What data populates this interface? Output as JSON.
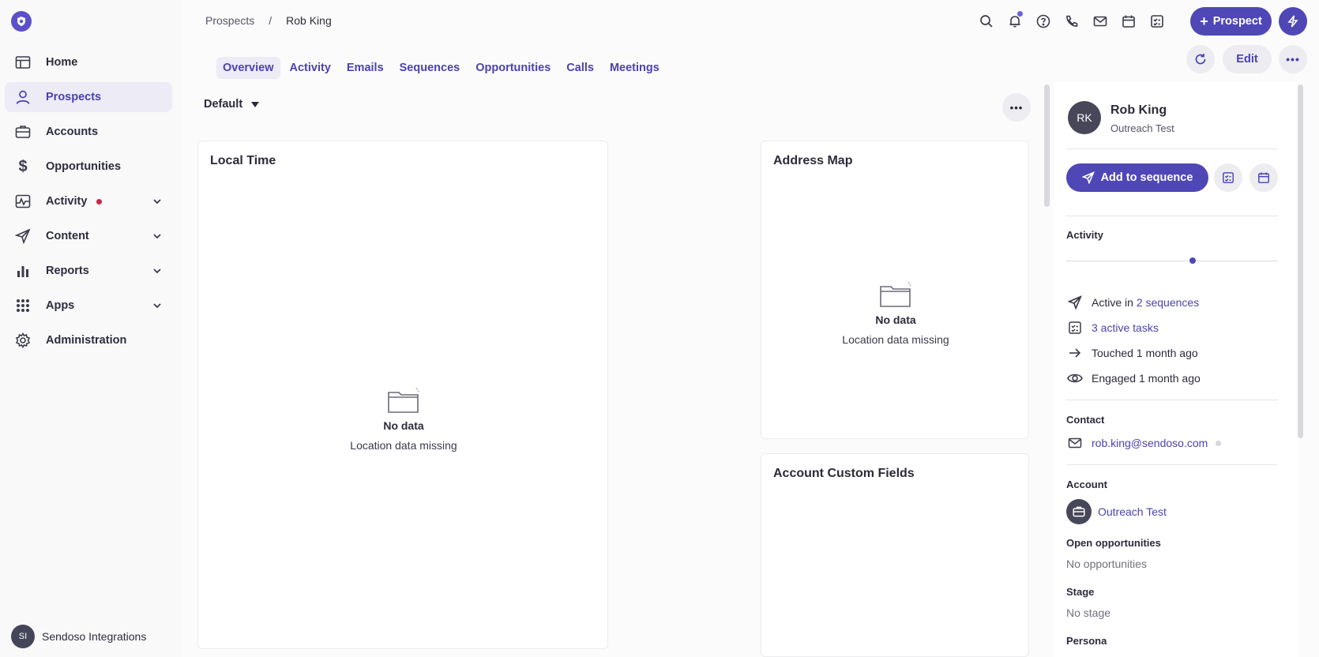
{
  "sidebar": {
    "logo_icon": "shield-icon",
    "items": [
      {
        "label": "Home",
        "icon": "table-icon",
        "active": false
      },
      {
        "label": "Prospects",
        "icon": "person-icon",
        "active": true
      },
      {
        "label": "Accounts",
        "icon": "briefcase-icon",
        "active": false
      },
      {
        "label": "Opportunities",
        "icon": "dollar-icon",
        "active": false
      },
      {
        "label": "Activity",
        "icon": "activity-icon",
        "active": false,
        "has_badge": true,
        "expandable": true
      },
      {
        "label": "Content",
        "icon": "send-icon",
        "active": false,
        "expandable": true
      },
      {
        "label": "Reports",
        "icon": "bar-chart-icon",
        "active": false,
        "expandable": true
      },
      {
        "label": "Apps",
        "icon": "grid-icon",
        "active": false,
        "expandable": true
      },
      {
        "label": "Administration",
        "icon": "gear-icon",
        "active": false
      }
    ],
    "user": {
      "initials": "SI",
      "name": "Sendoso Integrations"
    }
  },
  "header": {
    "breadcrumb": {
      "parent": "Prospects",
      "separator": "/",
      "current": "Rob King"
    },
    "add_button_label": "Prospect",
    "icons": [
      "search-icon",
      "bell-icon",
      "help-icon",
      "phone-icon",
      "mail-icon",
      "calendar-icon",
      "task-icon"
    ]
  },
  "tabs": [
    "Overview",
    "Activity",
    "Emails",
    "Sequences",
    "Opportunities",
    "Calls",
    "Meetings"
  ],
  "toolbar": {
    "edit_label": "Edit"
  },
  "main": {
    "view_selector": "Default",
    "cards": {
      "local_time": {
        "title": "Local Time",
        "empty_title": "No data",
        "empty_desc": "Location data missing"
      },
      "address_map": {
        "title": "Address Map",
        "empty_title": "No data",
        "empty_desc": "Location data missing"
      },
      "account_custom_fields": {
        "title": "Account Custom Fields"
      }
    }
  },
  "panel": {
    "initials": "RK",
    "name": "Rob King",
    "subtitle": "Outreach Test",
    "add_to_sequence_label": "Add to sequence",
    "activity_label": "Activity",
    "stats": {
      "active_in_prefix": "Active in",
      "active_in_link": "2 sequences",
      "tasks_link": "3 active tasks",
      "touched": "Touched 1 month ago",
      "engaged": "Engaged 1 month ago"
    },
    "contact_label": "Contact",
    "email": "rob.king@sendoso.com",
    "account_label": "Account",
    "account_name": "Outreach Test",
    "open_opps_label": "Open opportunities",
    "open_opps_value": "No opportunities",
    "stage_label": "Stage",
    "stage_value": "No stage",
    "persona_label": "Persona"
  },
  "colors": {
    "accent": "#4f47b6",
    "badge": "#c4274a",
    "link": "#4b42b0"
  }
}
